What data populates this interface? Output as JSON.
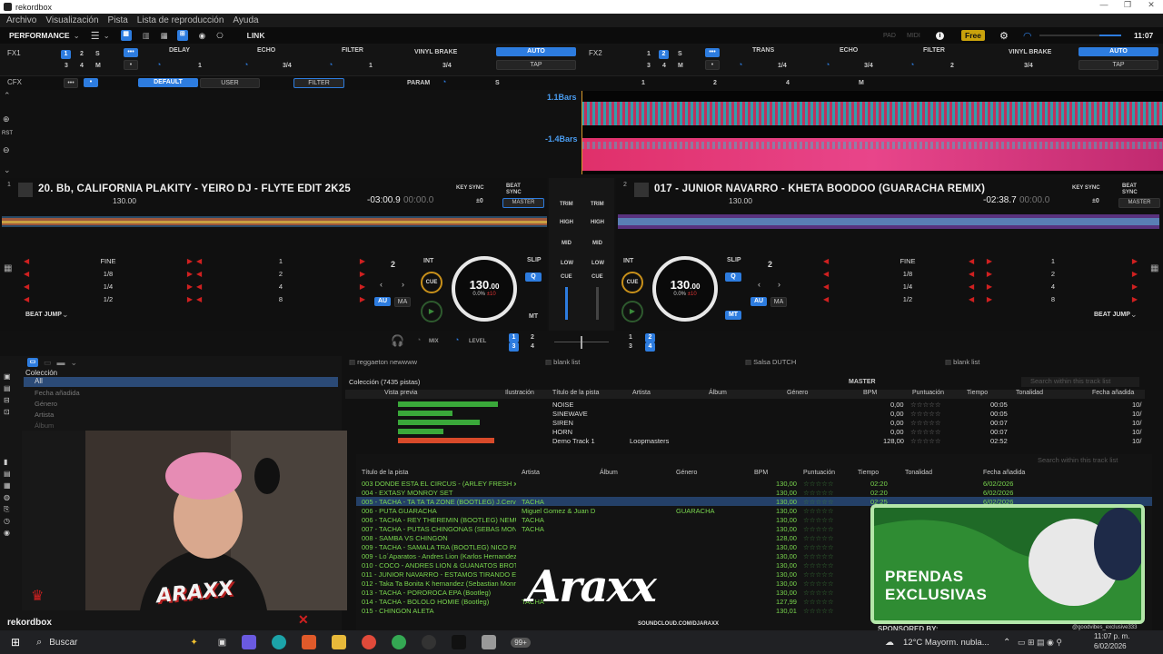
{
  "app": {
    "title": "rekordbox",
    "window_controls": [
      "—",
      "❐",
      "✕"
    ]
  },
  "menu": [
    "Archivo",
    "Visualización",
    "Pista",
    "Lista de reproducción",
    "Ayuda"
  ],
  "toolbar": {
    "mode": "PERFORMANCE",
    "link": "LINK",
    "pad": "PAD",
    "midi": "MIDI",
    "plan": "Free",
    "time": "11:07"
  },
  "fx1": {
    "label": "FX1",
    "effects": [
      "DELAY",
      "ECHO",
      "FILTER",
      "VINYL BRAKE"
    ],
    "beats": [
      "1",
      "3/4",
      "1",
      "3/4"
    ],
    "auto": "AUTO",
    "tap": "TAP",
    "buttons": [
      "1",
      "2",
      "S",
      "3",
      "4",
      "M"
    ]
  },
  "fx2": {
    "label": "FX2",
    "effects": [
      "TRANS",
      "ECHO",
      "FILTER",
      "VINYL BRAKE"
    ],
    "beats": [
      "1/4",
      "3/4",
      "2",
      "3/4"
    ],
    "auto": "AUTO",
    "tap": "TAP",
    "buttons": [
      "1",
      "2",
      "S",
      "3",
      "4",
      "M"
    ]
  },
  "cfx": {
    "label": "CFX",
    "default": "DEFAULT",
    "user": "USER",
    "filter": "FILTER",
    "param": "PARAM",
    "s": "S",
    "n1": "1",
    "n2": "2",
    "n4": "4",
    "m": "M"
  },
  "waveform": {
    "top_label": "1.1Bars",
    "bottom_label": "-1.4Bars",
    "rst": "RST"
  },
  "deck1": {
    "num": "1",
    "title": "20. Bb, CALIFORNIA PLAKITY - YEIRO DJ - FLYTE EDIT 2K25",
    "bpm": "130.00",
    "time": "-03:00.9",
    "time2": "00:00.0",
    "keysync": "KEY SYNC",
    "beatsync": "BEAT SYNC",
    "master": "MASTER",
    "key_offset": "±0",
    "beatjump_labels": [
      "FINE",
      "1/8",
      "1/4",
      "1/2"
    ],
    "beatjump_nums": [
      "1",
      "2",
      "4",
      "8"
    ],
    "loop_count": "2",
    "int": "INT",
    "cue": "CUE",
    "au": "AU",
    "ma": "MA",
    "slip": "SLIP",
    "q": "Q",
    "mt": "MT",
    "jog_bpm": "130",
    "jog_dec": ".00",
    "jog_pitch": "0.0%",
    "jog_range": "±10",
    "beat_jump": "BEAT JUMP"
  },
  "deck2": {
    "num": "2",
    "title": "017 - JUNIOR NAVARRO - KHETA BOODOO (GUARACHA REMIX)",
    "bpm": "130.00",
    "time": "-02:38.7",
    "time2": "00:00.0",
    "keysync": "KEY SYNC",
    "beatsync": "BEAT SYNC",
    "master": "MASTER",
    "key_offset": "±0",
    "beatjump_labels": [
      "FINE",
      "1/8",
      "1/4",
      "1/2"
    ],
    "beatjump_nums": [
      "1",
      "2",
      "4",
      "8"
    ],
    "loop_count": "2",
    "int": "INT",
    "cue": "CUE",
    "au": "AU",
    "ma": "MA",
    "slip": "SLIP",
    "q": "Q",
    "mt": "MT",
    "jog_bpm": "130",
    "jog_dec": ".00",
    "jog_pitch": "0.0%",
    "jog_range": "±10",
    "beat_jump": "BEAT JUMP"
  },
  "mixer": {
    "trim": "TRIM",
    "high": "HIGH",
    "mid": "MID",
    "low": "LOW",
    "cue": "CUE",
    "mix": "MIX",
    "level": "LEVEL"
  },
  "sidebar": {
    "collection": "Colección",
    "items": [
      "All",
      "Fecha añadida",
      "Género",
      "Artista",
      "Álbum"
    ]
  },
  "playlist_tabs": [
    "reggaeton newwww",
    "blank list",
    "Salsa DUTCH",
    "blank list"
  ],
  "collection": {
    "header": "Colección (7435 pistas)",
    "master": "MASTER",
    "search": "Search within this track list",
    "columns": [
      "Vista previa",
      "Ilustración",
      "Título de la pista",
      "Artista",
      "Álbum",
      "Género",
      "BPM",
      "Puntuación",
      "Tiempo",
      "Tonalidad",
      "Fecha añadida"
    ],
    "rows": [
      [
        "NOISE",
        "",
        "",
        "0,00",
        "00:05",
        "10/"
      ],
      [
        "SINEWAVE",
        "",
        "",
        "0,00",
        "00:05",
        "10/"
      ],
      [
        "SIREN",
        "",
        "",
        "0,00",
        "00:07",
        "10/"
      ],
      [
        "HORN",
        "",
        "",
        "0,00",
        "00:07",
        "10/"
      ],
      [
        "Demo Track 1",
        "Loopmasters",
        "",
        "128,00",
        "02:52",
        "10/"
      ]
    ]
  },
  "playlist": {
    "search": "Search within this track list",
    "columns": [
      "Título de la pista",
      "Artista",
      "Álbum",
      "Género",
      "BPM",
      "Puntuación",
      "Tiempo",
      "Tonalidad",
      "Fecha añadida"
    ],
    "rows": [
      [
        "003 DONDE ESTA EL CIRCUS - (ARLEY FRESH x",
        "",
        "",
        "",
        "130,00",
        "02:20",
        "6/02/2026"
      ],
      [
        "004 - EXTASY MONROY SET",
        "",
        "",
        "",
        "130,00",
        "02:20",
        "6/02/2026"
      ],
      [
        "005 - TACHA - TA TA TA ZONE (BOOTLEG) J.Cerv",
        "TACHA",
        "",
        "",
        "130,00",
        "02:25",
        "6/02/2026"
      ],
      [
        "006 - PUTA GUARACHA",
        "Miguel Gomez & Juan D",
        "",
        "GUARACHA",
        "130,00",
        "",
        ""
      ],
      [
        "006 - TACHA - REY THEREMIN (BOOTLEG) NEMU",
        "TACHA",
        "",
        "",
        "130,00",
        "",
        ""
      ],
      [
        "007 - TACHA - PUTAS CHINGONAS (SEBAS MON",
        "TACHA",
        "",
        "",
        "130,00",
        "",
        ""
      ],
      [
        "008 - SAMBA VS CHINGON",
        "",
        "",
        "",
        "128,00",
        "",
        ""
      ],
      [
        "009 - TACHA - SAMALA TRA (BOOTLEG) NICO PA",
        "",
        "",
        "",
        "130,00",
        "",
        ""
      ],
      [
        "009 - Lo´Aparatos - Andres Lion (Karlos Hernandez)",
        "",
        "",
        "",
        "130,00",
        "",
        ""
      ],
      [
        "010 - COCO - ANDRES LION & GUANATOS BROT",
        "",
        "",
        "",
        "130,00",
        "",
        ""
      ],
      [
        "011 - JUNIOR NAVARRO - ESTAMOS TIRANDO EL",
        "",
        "",
        "",
        "130,00",
        "",
        ""
      ],
      [
        "012 - Taka Ta Bonita K hernandez (Sebastian Monro",
        "",
        "",
        "",
        "130,00",
        "",
        ""
      ],
      [
        "013 - TACHA - POROROCA EPA (Bootleg)",
        "",
        "",
        "",
        "130,00",
        "",
        ""
      ],
      [
        "014 - TACHA - BOLOLO HOMIE (Bootleg)",
        "TACHA",
        "",
        "",
        "127,99",
        "",
        ""
      ],
      [
        "015 - CHINGON ALETA",
        "",
        "",
        "",
        "130,01",
        "",
        ""
      ]
    ]
  },
  "overlay": {
    "brand": "Araxx",
    "soundcloud": "SOUNDCLOUD.COM/DJARAXX",
    "rekordbox": "rekordbox",
    "webcam_logo": "ARAXX"
  },
  "promo": {
    "line1": "PRENDAS",
    "line2": "EXCLUSIVAS",
    "sponsored": "SPONSORED BY:",
    "handle": "@goodvibes_exclusive333"
  },
  "taskbar": {
    "search": "Buscar",
    "badge": "99+",
    "weather": "12°C  Mayorm. nubla...",
    "time": "11:07 p. m.",
    "date": "6/02/2026"
  }
}
